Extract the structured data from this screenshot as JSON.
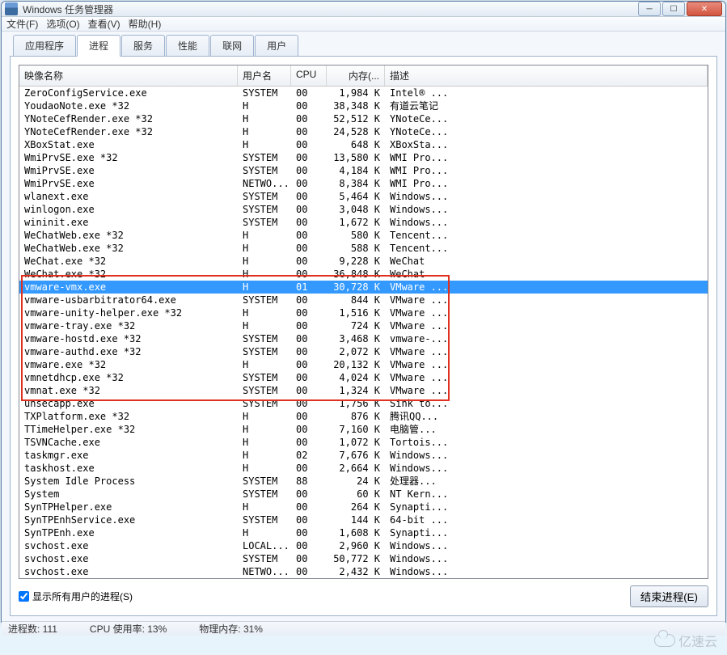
{
  "window": {
    "title": "Windows 任务管理器",
    "btn_min": "─",
    "btn_max": "☐",
    "btn_close": "✕"
  },
  "menu": {
    "file": "文件(F)",
    "options": "选项(O)",
    "view": "查看(V)",
    "help": "帮助(H)"
  },
  "tabs": {
    "apps": "应用程序",
    "processes": "进程",
    "services": "服务",
    "performance": "性能",
    "network": "联网",
    "users": "用户"
  },
  "columns": {
    "name": "映像名称",
    "user": "用户名",
    "cpu": "CPU",
    "mem": "内存(...",
    "desc": "描述"
  },
  "footer": {
    "show_all": "显示所有用户的进程(S)",
    "end_process": "结束进程(E)"
  },
  "status": {
    "proc_count": "进程数: 111",
    "cpu_usage": "CPU 使用率: 13%",
    "mem_usage": "物理内存: 31%"
  },
  "watermark": "亿速云",
  "processes": [
    {
      "name": "ZeroConfigService.exe",
      "user": "SYSTEM",
      "cpu": "00",
      "mem": "1,984 K",
      "desc": "Intel® ...",
      "sel": false
    },
    {
      "name": "YoudaoNote.exe *32",
      "user": "H",
      "cpu": "00",
      "mem": "38,348 K",
      "desc": "有道云笔记",
      "sel": false
    },
    {
      "name": "YNoteCefRender.exe *32",
      "user": "H",
      "cpu": "00",
      "mem": "52,512 K",
      "desc": "YNoteCe...",
      "sel": false
    },
    {
      "name": "YNoteCefRender.exe *32",
      "user": "H",
      "cpu": "00",
      "mem": "24,528 K",
      "desc": "YNoteCe...",
      "sel": false
    },
    {
      "name": "XBoxStat.exe",
      "user": "H",
      "cpu": "00",
      "mem": "648 K",
      "desc": "XBoxSta...",
      "sel": false
    },
    {
      "name": "WmiPrvSE.exe *32",
      "user": "SYSTEM",
      "cpu": "00",
      "mem": "13,580 K",
      "desc": "WMI Pro...",
      "sel": false
    },
    {
      "name": "WmiPrvSE.exe",
      "user": "SYSTEM",
      "cpu": "00",
      "mem": "4,184 K",
      "desc": "WMI Pro...",
      "sel": false
    },
    {
      "name": "WmiPrvSE.exe",
      "user": "NETWO...",
      "cpu": "00",
      "mem": "8,384 K",
      "desc": "WMI Pro...",
      "sel": false
    },
    {
      "name": "wlanext.exe",
      "user": "SYSTEM",
      "cpu": "00",
      "mem": "5,464 K",
      "desc": "Windows...",
      "sel": false
    },
    {
      "name": "winlogon.exe",
      "user": "SYSTEM",
      "cpu": "00",
      "mem": "3,048 K",
      "desc": "Windows...",
      "sel": false
    },
    {
      "name": "wininit.exe",
      "user": "SYSTEM",
      "cpu": "00",
      "mem": "1,672 K",
      "desc": "Windows...",
      "sel": false
    },
    {
      "name": "WeChatWeb.exe *32",
      "user": "H",
      "cpu": "00",
      "mem": "580 K",
      "desc": "Tencent...",
      "sel": false
    },
    {
      "name": "WeChatWeb.exe *32",
      "user": "H",
      "cpu": "00",
      "mem": "588 K",
      "desc": "Tencent...",
      "sel": false
    },
    {
      "name": "WeChat.exe *32",
      "user": "H",
      "cpu": "00",
      "mem": "9,228 K",
      "desc": "WeChat",
      "sel": false
    },
    {
      "name": "WeChat.exe *32",
      "user": "H",
      "cpu": "00",
      "mem": "36,848 K",
      "desc": "WeChat",
      "sel": false
    },
    {
      "name": "vmware-vmx.exe",
      "user": "H",
      "cpu": "01",
      "mem": "30,728 K",
      "desc": "VMware ...",
      "sel": true
    },
    {
      "name": "vmware-usbarbitrator64.exe",
      "user": "SYSTEM",
      "cpu": "00",
      "mem": "844 K",
      "desc": "VMware ...",
      "sel": false
    },
    {
      "name": "vmware-unity-helper.exe *32",
      "user": "H",
      "cpu": "00",
      "mem": "1,516 K",
      "desc": "VMware ...",
      "sel": false
    },
    {
      "name": "vmware-tray.exe *32",
      "user": "H",
      "cpu": "00",
      "mem": "724 K",
      "desc": "VMware ...",
      "sel": false
    },
    {
      "name": "vmware-hostd.exe *32",
      "user": "SYSTEM",
      "cpu": "00",
      "mem": "3,468 K",
      "desc": "vmware-...",
      "sel": false
    },
    {
      "name": "vmware-authd.exe *32",
      "user": "SYSTEM",
      "cpu": "00",
      "mem": "2,072 K",
      "desc": "VMware ...",
      "sel": false
    },
    {
      "name": "vmware.exe *32",
      "user": "H",
      "cpu": "00",
      "mem": "20,132 K",
      "desc": "VMware ...",
      "sel": false
    },
    {
      "name": "vmnetdhcp.exe *32",
      "user": "SYSTEM",
      "cpu": "00",
      "mem": "4,024 K",
      "desc": "VMware ...",
      "sel": false
    },
    {
      "name": "vmnat.exe *32",
      "user": "SYSTEM",
      "cpu": "00",
      "mem": "1,324 K",
      "desc": "VMware ...",
      "sel": false
    },
    {
      "name": "unsecapp.exe",
      "user": "SYSTEM",
      "cpu": "00",
      "mem": "1,756 K",
      "desc": "Sink to...",
      "sel": false
    },
    {
      "name": "TXPlatform.exe *32",
      "user": "H",
      "cpu": "00",
      "mem": "876 K",
      "desc": "腾讯QQ...",
      "sel": false
    },
    {
      "name": "TTimeHelper.exe *32",
      "user": "H",
      "cpu": "00",
      "mem": "7,160 K",
      "desc": "电脑管...",
      "sel": false
    },
    {
      "name": "TSVNCache.exe",
      "user": "H",
      "cpu": "00",
      "mem": "1,072 K",
      "desc": "Tortois...",
      "sel": false
    },
    {
      "name": "taskmgr.exe",
      "user": "H",
      "cpu": "02",
      "mem": "7,676 K",
      "desc": "Windows...",
      "sel": false
    },
    {
      "name": "taskhost.exe",
      "user": "H",
      "cpu": "00",
      "mem": "2,664 K",
      "desc": "Windows...",
      "sel": false
    },
    {
      "name": "System Idle Process",
      "user": "SYSTEM",
      "cpu": "88",
      "mem": "24 K",
      "desc": "处理器...",
      "sel": false
    },
    {
      "name": "System",
      "user": "SYSTEM",
      "cpu": "00",
      "mem": "60 K",
      "desc": "NT Kern...",
      "sel": false
    },
    {
      "name": "SynTPHelper.exe",
      "user": "H",
      "cpu": "00",
      "mem": "264 K",
      "desc": "Synapti...",
      "sel": false
    },
    {
      "name": "SynTPEnhService.exe",
      "user": "SYSTEM",
      "cpu": "00",
      "mem": "144 K",
      "desc": "64-bit ...",
      "sel": false
    },
    {
      "name": "SynTPEnh.exe",
      "user": "H",
      "cpu": "00",
      "mem": "1,608 K",
      "desc": "Synapti...",
      "sel": false
    },
    {
      "name": "svchost.exe",
      "user": "LOCAL...",
      "cpu": "00",
      "mem": "2,960 K",
      "desc": "Windows...",
      "sel": false
    },
    {
      "name": "svchost.exe",
      "user": "SYSTEM",
      "cpu": "00",
      "mem": "50,772 K",
      "desc": "Windows...",
      "sel": false
    },
    {
      "name": "svchost.exe",
      "user": "NETWO...",
      "cpu": "00",
      "mem": "2,432 K",
      "desc": "Windows...",
      "sel": false
    }
  ],
  "highlight": {
    "start": 15,
    "end": 23
  }
}
